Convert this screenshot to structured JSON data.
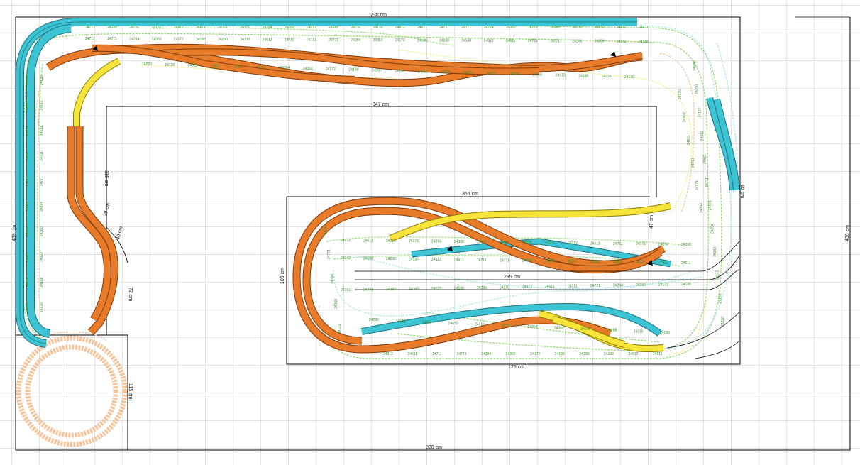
{
  "layout": {
    "dimensions": {
      "width_top": "730 cm",
      "width_inner": "347 cm",
      "height_right_outer": "439 cm",
      "width_bottom": "820 cm",
      "lower_box_top": "365 cm",
      "lower_box_height": "109 cm",
      "mid_label": "295 cm",
      "lower_box_bottom": "125 cm",
      "left_vertical": "115 cm",
      "left_lower": "115 cm",
      "left_mid": "72 cm",
      "right_mid": "65 cm",
      "right_small": "47 cm",
      "diag_a": "20 cm",
      "diag_b": "40 cm",
      "left_outer": "439 cm"
    },
    "level_colors": {
      "main": "#e87b2a",
      "upper": "#3cc4d4",
      "yellow": "#f6e43a",
      "hidden_green": "#8cd46a",
      "hidden_cyan": "#a9e6ee",
      "hidden_peach": "#f4c49c",
      "label_green": "#3b8c2c"
    },
    "track_labels": [
      "24172",
      "24188",
      "24230",
      "24130",
      "24912",
      "24611",
      "24711",
      "24771",
      "24294",
      "24360"
    ]
  }
}
